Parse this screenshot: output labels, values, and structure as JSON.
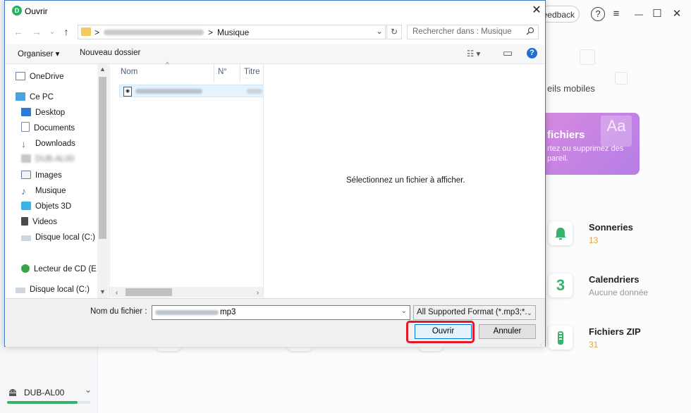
{
  "background_app": {
    "feedback_label": "eedback",
    "help_glyph": "?",
    "menu_glyph": "≡",
    "minimize_glyph": "—",
    "maximize_glyph": "☐",
    "close_glyph": "✕",
    "mobiles_text": "eils mobiles",
    "card": {
      "title": "fichiers",
      "subtitle": "rtez ou supprimez des pareil.",
      "icon_text": "Aa"
    },
    "tiles": [
      {
        "title": "Sonneries",
        "subtitle": "13",
        "icon": "bell-icon"
      },
      {
        "title": "Calendriers",
        "subtitle": "Aucune donnée",
        "icon": "calendar-icon",
        "icon_text": "3"
      },
      {
        "title": "Fichiers ZIP",
        "subtitle": "31",
        "icon": "zip-icon"
      }
    ],
    "device": {
      "name": "DUB-AL00",
      "chevron": "⌄",
      "storage_fraction": 0.85
    },
    "colors": {
      "accent_green": "#39b36b",
      "pink_card": "#c983e3",
      "orange": "#e6a23c"
    }
  },
  "dialog": {
    "title": "Ouvrir",
    "app_icon_glyph": "D",
    "close_glyph": "✕",
    "nav": {
      "back": "←",
      "forward": "→",
      "history": "⌄",
      "up": "↑"
    },
    "address": {
      "separator": ">",
      "current_folder": "Musique",
      "dropdown_glyph": "⌄",
      "refresh_glyph": "↻"
    },
    "search": {
      "placeholder": "Rechercher dans : Musique",
      "icon": "search-icon"
    },
    "toolbar": {
      "organize_label": "Organiser ▾",
      "new_folder_label": "Nouveau dossier",
      "view_glyph": "☷ ▾",
      "pane_glyph": "▭",
      "help_glyph": "?"
    },
    "nav_pane": {
      "items": [
        {
          "label": "OneDrive",
          "icon": "onedrive-icon"
        },
        {
          "label": "Ce PC",
          "icon": "computer-icon"
        },
        {
          "label": "Desktop",
          "icon": "desktop-icon"
        },
        {
          "label": "Documents",
          "icon": "documents-icon"
        },
        {
          "label": "Downloads",
          "icon": "downloads-icon"
        },
        {
          "label": "DUB-AL00",
          "icon": "phone-icon"
        },
        {
          "label": "Images",
          "icon": "images-icon"
        },
        {
          "label": "Musique",
          "icon": "music-icon"
        },
        {
          "label": "Objets 3D",
          "icon": "objects3d-icon"
        },
        {
          "label": "Videos",
          "icon": "videos-icon"
        },
        {
          "label": "Disque local (C:)",
          "icon": "drive-icon"
        },
        {
          "label": "Lecteur de CD (E",
          "icon": "cd-drive-icon"
        },
        {
          "label": "Disque local (C:)",
          "icon": "drive-icon"
        }
      ]
    },
    "file_list": {
      "columns": [
        "Nom",
        "N°",
        "Titre"
      ],
      "sort_glyph": "^",
      "files": [
        {
          "type": "audio"
        }
      ]
    },
    "preview": {
      "message": "Sélectionnez un fichier à afficher."
    },
    "bottom": {
      "filename_label": "Nom du fichier :",
      "filename_visible_suffix": "mp3",
      "filter_value": "All Supported Format (*.mp3;*.",
      "open_label": "Ouvrir",
      "cancel_label": "Annuler"
    },
    "colors": {
      "highlight_red": "#e2192b",
      "primary_blue": "#0078d7"
    }
  }
}
